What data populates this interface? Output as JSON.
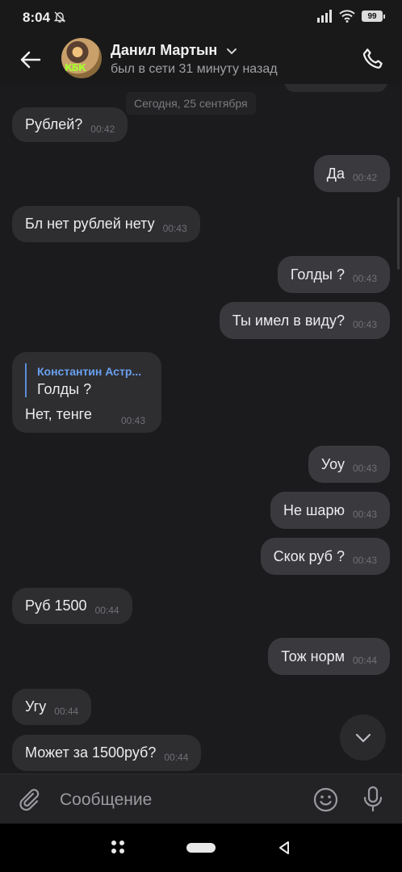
{
  "status_bar": {
    "time": "8:04",
    "battery": "99"
  },
  "header": {
    "contact_name": "Данил Мартын",
    "contact_status": "был в сети 31 минуту назад",
    "avatar_text": "КБК"
  },
  "chat": {
    "date_chip": "Сегодня, 25 сентября",
    "messages": [
      {
        "dir": "in",
        "text": "Рублей?",
        "time": "00:42"
      },
      {
        "dir": "out",
        "text": "Да",
        "time": "00:42"
      },
      {
        "dir": "in",
        "text": "Бл нет рублей нету",
        "time": "00:43"
      },
      {
        "dir": "out",
        "text": "Голды ?",
        "time": "00:43"
      },
      {
        "dir": "out",
        "text": "Ты имел в виду?",
        "time": "00:43"
      },
      {
        "dir": "in",
        "reply_author": "Константин Астр...",
        "reply_text": "Голды ?",
        "text": "Нет, тенге",
        "time": "00:43"
      },
      {
        "dir": "out",
        "text": "Уоу",
        "time": "00:43"
      },
      {
        "dir": "out",
        "text": "Не шарю",
        "time": "00:43"
      },
      {
        "dir": "out",
        "text": "Скок руб ?",
        "time": "00:43"
      },
      {
        "dir": "in",
        "text": "Руб 1500",
        "time": "00:44"
      },
      {
        "dir": "out",
        "text": "Тож норм",
        "time": "00:44"
      },
      {
        "dir": "in",
        "text": "Угу",
        "time": "00:44"
      },
      {
        "dir": "in",
        "text": "Может за 1500руб?",
        "time": "00:44"
      }
    ]
  },
  "composer": {
    "placeholder": "Сообщение"
  },
  "icons": {
    "back": "arrow-left-icon",
    "call": "phone-icon",
    "attach": "paperclip-icon",
    "emoji": "smiley-icon",
    "mic": "microphone-icon",
    "scroll_down": "chevron-down-icon"
  },
  "colors": {
    "background": "#1b1b1d",
    "bubble_in": "#2e2e31",
    "bubble_out": "#3a3a3e",
    "reply_accent": "#6aa0f0"
  }
}
